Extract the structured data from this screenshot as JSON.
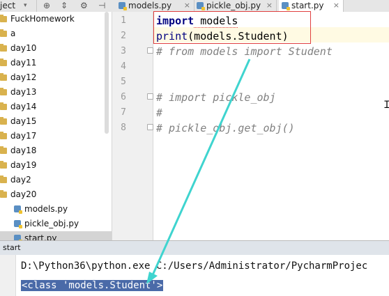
{
  "toolbar": {
    "project_dropdown_label": "ject",
    "icons": [
      "globe-icon",
      "split-icon",
      "gear-icon",
      "hide-icon"
    ]
  },
  "tabs": [
    {
      "label": "models.py",
      "active": false
    },
    {
      "label": "pickle_obj.py",
      "active": false
    },
    {
      "label": "start.py",
      "active": true
    }
  ],
  "project_tree": {
    "items": [
      {
        "label": "FuckHomework",
        "kind": "folder"
      },
      {
        "label": "a",
        "kind": "folder"
      },
      {
        "label": "day10",
        "kind": "folder"
      },
      {
        "label": "day11",
        "kind": "folder"
      },
      {
        "label": "day12",
        "kind": "folder"
      },
      {
        "label": "day13",
        "kind": "folder"
      },
      {
        "label": "day14",
        "kind": "folder"
      },
      {
        "label": "day15",
        "kind": "folder"
      },
      {
        "label": "day17",
        "kind": "folder"
      },
      {
        "label": "day18",
        "kind": "folder"
      },
      {
        "label": "day19",
        "kind": "folder"
      },
      {
        "label": "day2",
        "kind": "folder"
      },
      {
        "label": "day20",
        "kind": "folder"
      },
      {
        "label": "models.py",
        "kind": "file"
      },
      {
        "label": "pickle_obj.py",
        "kind": "file"
      },
      {
        "label": "start.py",
        "kind": "file",
        "selected": true
      }
    ]
  },
  "editor": {
    "line_numbers": [
      "1",
      "2",
      "3",
      "4",
      "5",
      "6",
      "7",
      "8"
    ],
    "lines": [
      {
        "parts": [
          {
            "t": "import",
            "c": "kw"
          },
          {
            "t": " models",
            "c": "plain"
          }
        ]
      },
      {
        "parts": [
          {
            "t": "print",
            "c": "fn"
          },
          {
            "t": "(models.Student)",
            "c": "plain"
          }
        ]
      },
      {
        "parts": [
          {
            "t": "# from models import Student",
            "c": "cm"
          }
        ]
      },
      {
        "parts": []
      },
      {
        "parts": []
      },
      {
        "parts": [
          {
            "t": "# import pickle_obj",
            "c": "cm"
          }
        ]
      },
      {
        "parts": [
          {
            "t": "#",
            "c": "cm"
          }
        ]
      },
      {
        "parts": [
          {
            "t": "# pickle_obj.get_obj()",
            "c": "cm"
          }
        ]
      }
    ]
  },
  "run_panel": {
    "title": "start",
    "command": "D:\\Python36\\python.exe C:/Users/Administrator/PycharmProjec",
    "output": "<class 'models.Student'>"
  },
  "colors": {
    "annotation_box": "#e04040",
    "arrow": "#3fd4cf",
    "selection": "#4a6aa8"
  }
}
